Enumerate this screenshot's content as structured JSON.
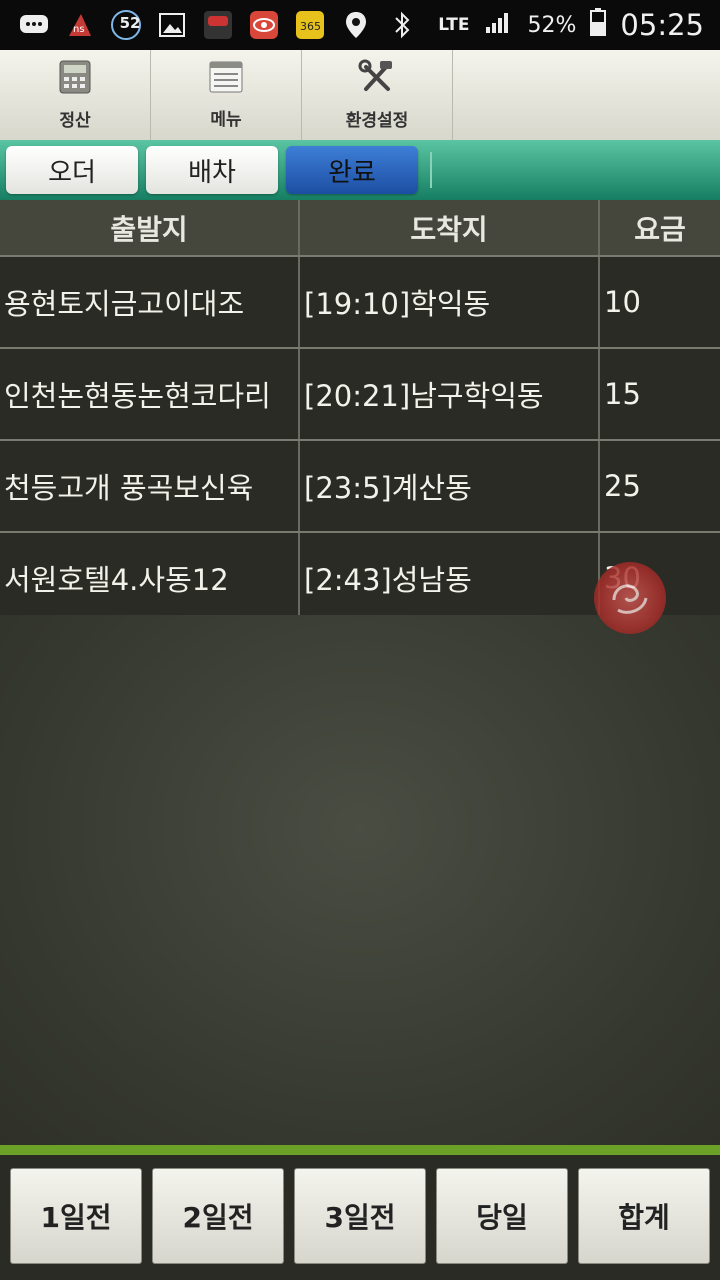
{
  "status_bar": {
    "notif_badge": "52",
    "network": "LTE",
    "battery": "52%",
    "time": "05:25"
  },
  "toolbar": {
    "items": [
      {
        "label": "정산",
        "icon": "calculator-icon"
      },
      {
        "label": "메뉴",
        "icon": "menu-list-icon"
      },
      {
        "label": "환경설정",
        "icon": "tools-icon"
      }
    ]
  },
  "tabs": [
    {
      "label": "오더",
      "active": false
    },
    {
      "label": "배차",
      "active": false
    },
    {
      "label": "완료",
      "active": true
    }
  ],
  "table": {
    "headers": [
      "출발지",
      "도착지",
      "요금"
    ],
    "rows": [
      [
        "용현토지금고이대조",
        "[19:10]학익동",
        "10"
      ],
      [
        "인천논현동논현코다리",
        "[20:21]남구학익동",
        "15"
      ],
      [
        "천등고개 풍곡보신육",
        "[23:5]계산동",
        "25"
      ],
      [
        "서원호텔4.사동12",
        "[2:43]성남동",
        "30"
      ]
    ]
  },
  "bottom_buttons": [
    "1일전",
    "2일전",
    "3일전",
    "당일",
    "합계"
  ],
  "colors": {
    "tab_strip": "#1f9a78",
    "active_tab": "#2b63be",
    "bottom_accent": "#6aa126",
    "table_bg": "#2a2b24"
  }
}
